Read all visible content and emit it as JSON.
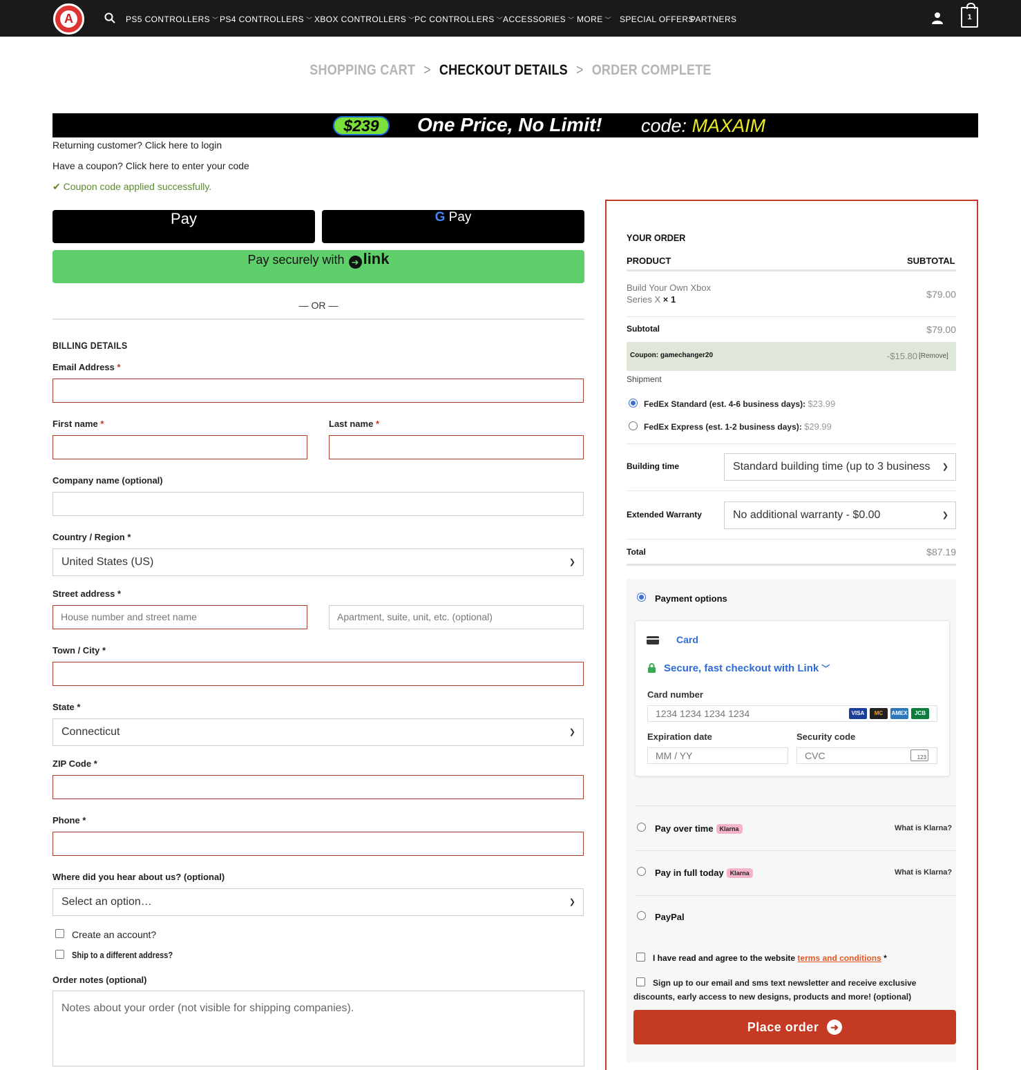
{
  "nav": {
    "items": [
      {
        "label": "PS5 CONTROLLERS",
        "has_dropdown": true
      },
      {
        "label": "PS4 CONTROLLERS",
        "has_dropdown": true
      },
      {
        "label": "XBOX CONTROLLERS",
        "has_dropdown": true
      },
      {
        "label": "PC CONTROLLERS",
        "has_dropdown": true
      },
      {
        "label": "ACCESSORIES",
        "has_dropdown": true
      },
      {
        "label": "MORE",
        "has_dropdown": true
      },
      {
        "label": "SPECIAL OFFERS",
        "has_dropdown": false
      },
      {
        "label": "PARTNERS",
        "has_dropdown": false
      }
    ],
    "logo_letter": "A",
    "cart_count": "1"
  },
  "breadcrumb": {
    "step1": "SHOPPING CART",
    "sep": ">",
    "step2": "CHECKOUT DETAILS",
    "step3": "ORDER COMPLETE"
  },
  "banner": {
    "price": "$239",
    "tagline": "One Price, No Limit!",
    "code_prefix": "code: ",
    "code": "MAXAIM"
  },
  "notices": {
    "returning": "Returning customer? Click here to login",
    "coupon": "Have a coupon? Click here to enter your code",
    "applied": "Coupon code applied successfully."
  },
  "wallet": {
    "apple": "Pay",
    "google": "Pay",
    "link_text": "Pay securely with",
    "link_brand": "link",
    "or": "— OR —"
  },
  "billing": {
    "title": "BILLING DETAILS",
    "email_label": "Email Address",
    "first_name_label": "First name",
    "last_name_label": "Last name",
    "company_label": "Company name (optional)",
    "country_label": "Country / Region",
    "country_value": "United States (US)",
    "street_label": "Street address",
    "street_placeholder": "House number and street name",
    "apt_placeholder": "Apartment, suite, unit, etc. (optional)",
    "city_label": "Town / City",
    "state_label": "State",
    "state_value": "Connecticut",
    "zip_label": "ZIP Code",
    "phone_label": "Phone",
    "hear_label": "Where did you hear about us? (optional)",
    "hear_value": "Select an option…",
    "create_account": "Create an account?",
    "ship_different": "Ship to a different address?",
    "notes_label": "Order notes (optional)",
    "notes_placeholder": "Notes about your order (not visible for shipping companies).",
    "required_mark": "*"
  },
  "order": {
    "title": "YOUR ORDER",
    "col_product": "PRODUCT",
    "col_subtotal": "SUBTOTAL",
    "item_name_1": "Build Your Own Xbox",
    "item_name_2": "Series X",
    "item_qty": "× 1",
    "item_price": "$79.00",
    "subtotal_label": "Subtotal",
    "subtotal_value": "$79.00",
    "coupon_label": "Coupon: gamechanger20",
    "coupon_value": "-$15.80",
    "coupon_remove": "[Remove]",
    "shipment_label": "Shipment",
    "ship_standard": "FedEx Standard (est. 4-6 business days):",
    "ship_standard_price": "$23.99",
    "ship_express": "FedEx Express (est. 1-2 business days):",
    "ship_express_price": "$29.99",
    "building_label": "Building time",
    "building_value": "Standard building time (up to 3 business",
    "warranty_label": "Extended Warranty",
    "warranty_value": "No additional warranty - $0.00",
    "total_label": "Total",
    "total_value": "$87.19"
  },
  "payment": {
    "options_label": "Payment options",
    "card_tab": "Card",
    "link_checkout": "Secure, fast checkout with Link",
    "card_number_label": "Card number",
    "card_number_placeholder": "1234 1234 1234 1234",
    "card_brands": [
      "VISA",
      "MC",
      "AMEX",
      "JCB"
    ],
    "exp_label": "Expiration date",
    "exp_placeholder": "MM / YY",
    "cvc_label": "Security code",
    "cvc_placeholder": "CVC",
    "cvc_icon_text": "123",
    "pay_over_time": "Pay over time",
    "pay_full_today": "Pay in full today",
    "klarna_badge": "Klarna",
    "what_klarna": "What is Klarna?",
    "paypal": "PayPal",
    "terms_prefix": "I have read and agree to the website",
    "terms_link": "terms and conditions",
    "newsletter_line1": "Sign up to our email and sms text newsletter and receive exclusive",
    "newsletter_line2": "discounts, early access to new designs, products and more! (optional)",
    "place_order": "Place order"
  },
  "colors": {
    "nav_bg": "#1a1a1a",
    "accent_red": "#c43a22",
    "link_green": "#5fcf6b",
    "success_green": "#5a8a2c",
    "stripe_blue": "#2e6bd4"
  }
}
